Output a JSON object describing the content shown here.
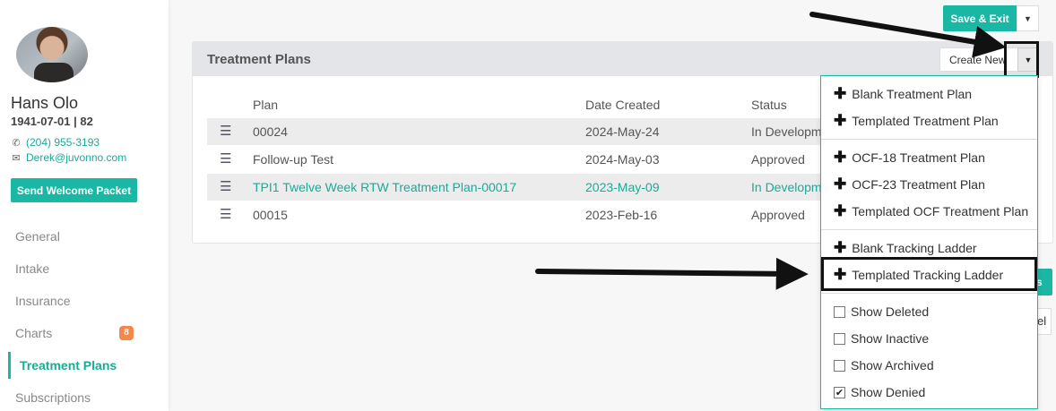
{
  "patient": {
    "name": "Hans Olo",
    "dob_age": "1941-07-01 | 82",
    "phone": "(204) 955-3193",
    "email": "Derek@juvonno.com",
    "welcome_button": "Send Welcome Packet"
  },
  "nav": {
    "items": [
      {
        "label": "General"
      },
      {
        "label": "Intake"
      },
      {
        "label": "Insurance"
      },
      {
        "label": "Charts",
        "badge": "8"
      },
      {
        "label": "Treatment Plans",
        "active": true
      },
      {
        "label": "Subscriptions"
      }
    ]
  },
  "toolbar": {
    "save_exit": "Save & Exit"
  },
  "panel": {
    "title": "Treatment Plans",
    "create_new": "Create New",
    "columns": {
      "plan": "Plan",
      "date": "Date Created",
      "status": "Status"
    },
    "rows": [
      {
        "plan": "00024",
        "date": "2024-May-24",
        "status": "In Developm"
      },
      {
        "plan": "Follow-up Test",
        "date": "2024-May-03",
        "status": "Approved"
      },
      {
        "plan": "TPI1 Twelve Week RTW Treatment Plan-00017",
        "date": "2023-May-09",
        "status": "In Developm"
      },
      {
        "plan": "00015",
        "date": "2023-Feb-16",
        "status": "Approved"
      }
    ]
  },
  "dropdown": {
    "create_items": [
      "Blank Treatment Plan",
      "Templated Treatment Plan",
      "OCF-18 Treatment Plan",
      "OCF-23 Treatment Plan",
      "Templated OCF Treatment Plan",
      "Blank Tracking Ladder",
      "Templated Tracking Ladder"
    ],
    "filters": [
      {
        "label": "Show Deleted",
        "checked": false
      },
      {
        "label": "Show Inactive",
        "checked": false
      },
      {
        "label": "Show Archived",
        "checked": false
      },
      {
        "label": "Show Denied",
        "checked": true
      }
    ]
  },
  "peek": {
    "teal_fragment": "s",
    "white_fragment": "el"
  },
  "colors": {
    "accent": "#1ab8a4",
    "badge": "#f3884a",
    "highlight": "#1aaa98"
  }
}
